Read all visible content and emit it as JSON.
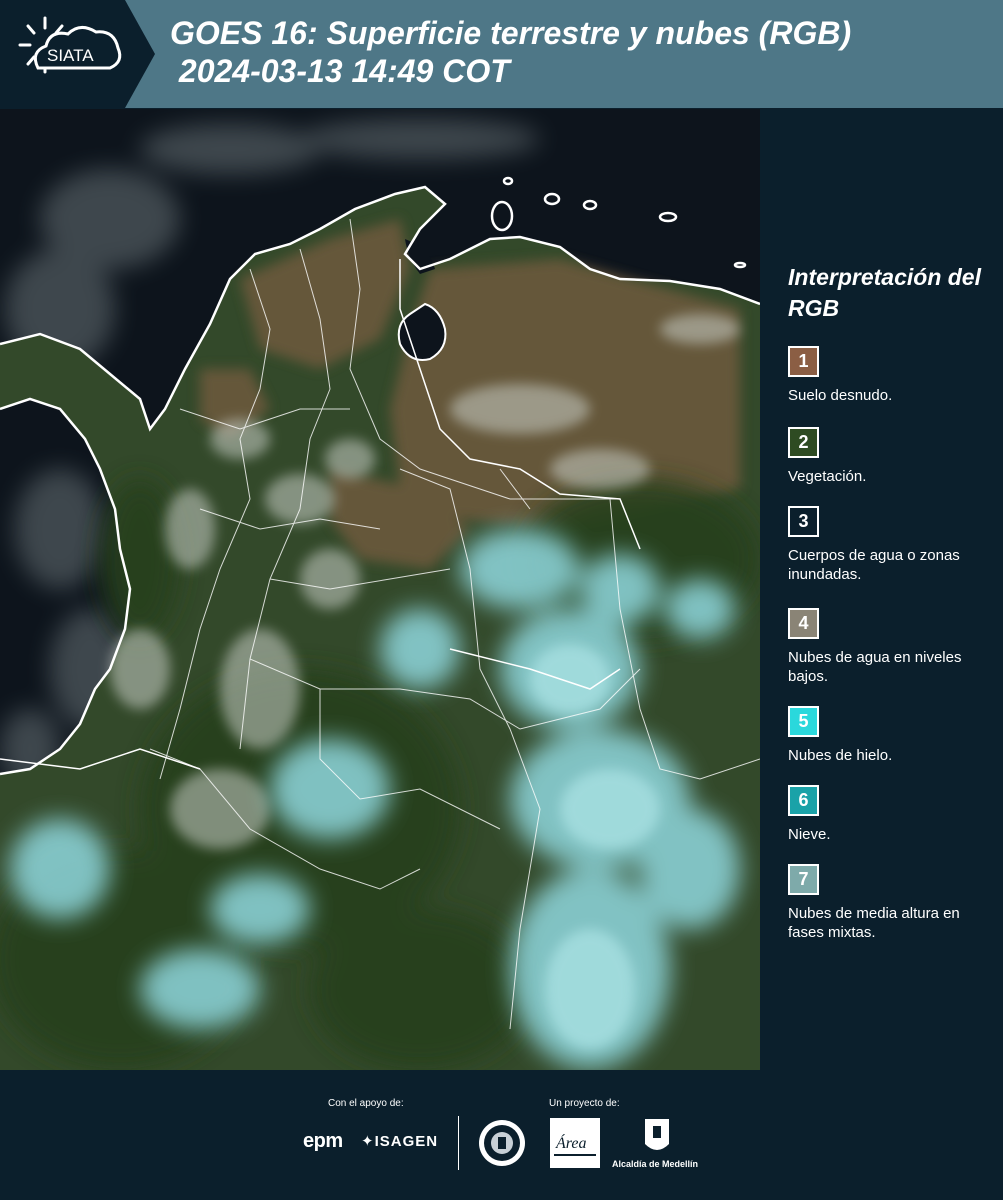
{
  "header": {
    "logo_text": "SIATA",
    "title": "GOES 16: Superficie terrestre y nubes (RGB)\n 2024-03-13 14:49 COT"
  },
  "legend": {
    "title": "Interpretación del RGB",
    "items": [
      {
        "number": "1",
        "label": "Suelo desnudo.",
        "color": "#8b5e44"
      },
      {
        "number": "2",
        "label": "Vegetación.",
        "color": "#2e4b22"
      },
      {
        "number": "3",
        "label": "Cuerpos de agua o zonas inundadas.",
        "color": "#0b1f2c"
      },
      {
        "number": "4",
        "label": "Nubes de agua en niveles bajos.",
        "color": "#8a8476"
      },
      {
        "number": "5",
        "label": "Nubes de hielo.",
        "color": "#2ad8dc"
      },
      {
        "number": "6",
        "label": "Nieve.",
        "color": "#1aa2a8"
      },
      {
        "number": "7",
        "label": "Nubes de media altura en fases mixtas.",
        "color": "#7eaaaa"
      }
    ]
  },
  "footer": {
    "support_label": "Con el apoyo de:",
    "project_label": "Un proyecto de:",
    "sponsors": [
      "epm",
      "ISAGEN"
    ],
    "partners": [
      "Área Metropolitana Valle de Aburrá",
      "Alcaldía de Medellín"
    ],
    "area_logo_text": "Área",
    "alcaldia_label": "Alcaldía de Medellín"
  },
  "colors": {
    "header_bg": "#4e7787",
    "page_bg": "#0b1f2c",
    "ocean": "#0e1620",
    "land": "#34472a",
    "bare_soil": "#6b5a3e",
    "ice_cloud": "#8fd6dc",
    "border": "#ffffff"
  }
}
